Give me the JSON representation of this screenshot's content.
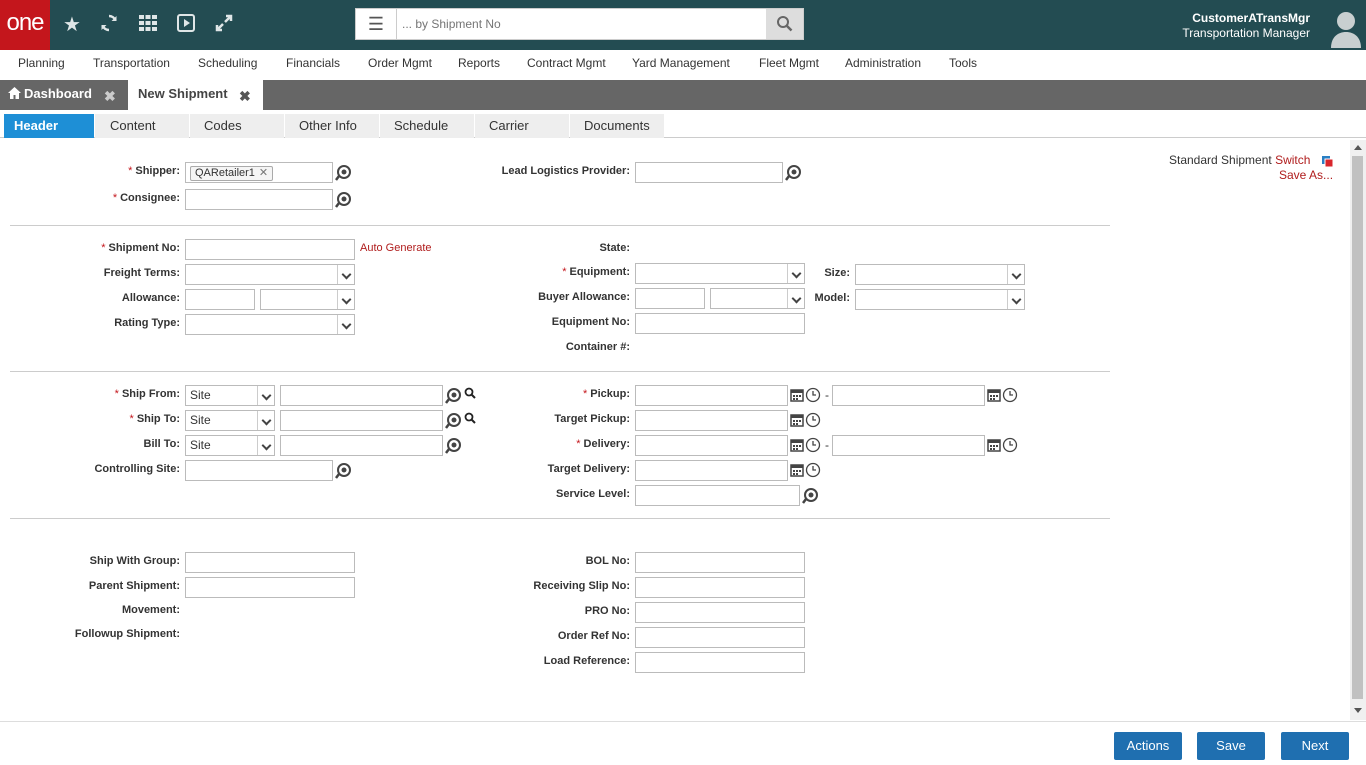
{
  "app": {
    "logo": "one",
    "search": {
      "placeholder": "... by Shipment No"
    },
    "user": {
      "name": "CustomerATransMgr",
      "role": "Transportation Manager"
    }
  },
  "nav": [
    "Planning",
    "Transportation",
    "Scheduling",
    "Financials",
    "Order Mgmt",
    "Reports",
    "Contract Mgmt",
    "Yard Management",
    "Fleet Mgmt",
    "Administration",
    "Tools"
  ],
  "doc_tabs": [
    {
      "label": "Dashboard"
    },
    {
      "label": "New Shipment"
    }
  ],
  "sub_tabs": [
    "Header",
    "Content",
    "Codes",
    "Other Info",
    "Schedule",
    "Carrier",
    "Documents"
  ],
  "form": {
    "shipper": {
      "label": "Shipper:",
      "chip": "QARetailer1"
    },
    "consignee": {
      "label": "Consignee:"
    },
    "llp": {
      "label": "Lead Logistics Provider:"
    },
    "shipment_no": {
      "label": "Shipment No:",
      "link": "Auto Generate"
    },
    "freight_terms": {
      "label": "Freight Terms:"
    },
    "allowance": {
      "label": "Allowance:"
    },
    "rating_type": {
      "label": "Rating Type:"
    },
    "state": {
      "label": "State:"
    },
    "equipment": {
      "label": "Equipment:"
    },
    "size": {
      "label": "Size:"
    },
    "buyer_allowance": {
      "label": "Buyer Allowance:"
    },
    "model": {
      "label": "Model:"
    },
    "equipment_no": {
      "label": "Equipment No:"
    },
    "container": {
      "label": "Container #:"
    },
    "ship_from": {
      "label": "Ship From:",
      "value": "Site"
    },
    "ship_to": {
      "label": "Ship To:",
      "value": "Site"
    },
    "bill_to": {
      "label": "Bill To:",
      "value": "Site"
    },
    "controlling_site": {
      "label": "Controlling Site:"
    },
    "pickup": {
      "label": "Pickup:"
    },
    "target_pickup": {
      "label": "Target Pickup:"
    },
    "delivery": {
      "label": "Delivery:"
    },
    "target_delivery": {
      "label": "Target Delivery:"
    },
    "service_level": {
      "label": "Service Level:"
    },
    "ship_with_group": {
      "label": "Ship With Group:"
    },
    "parent_shipment": {
      "label": "Parent Shipment:"
    },
    "movement": {
      "label": "Movement:"
    },
    "followup_shipment": {
      "label": "Followup Shipment:"
    },
    "bol_no": {
      "label": "BOL No:"
    },
    "receiving_slip_no": {
      "label": "Receiving Slip No:"
    },
    "pro_no": {
      "label": "PRO No:"
    },
    "order_ref_no": {
      "label": "Order Ref No:"
    },
    "load_reference": {
      "label": "Load Reference:"
    }
  },
  "side": {
    "type_label": "Standard Shipment",
    "switch_link": "Switch",
    "save_as_link": "Save As..."
  },
  "footer": {
    "actions": "Actions",
    "save": "Save",
    "next": "Next"
  },
  "colors": {
    "topbar": "#234c52",
    "logo": "#c4161c",
    "active_tab": "#1e8fd6",
    "button": "#1f6fb0",
    "link": "#b01c1c"
  }
}
